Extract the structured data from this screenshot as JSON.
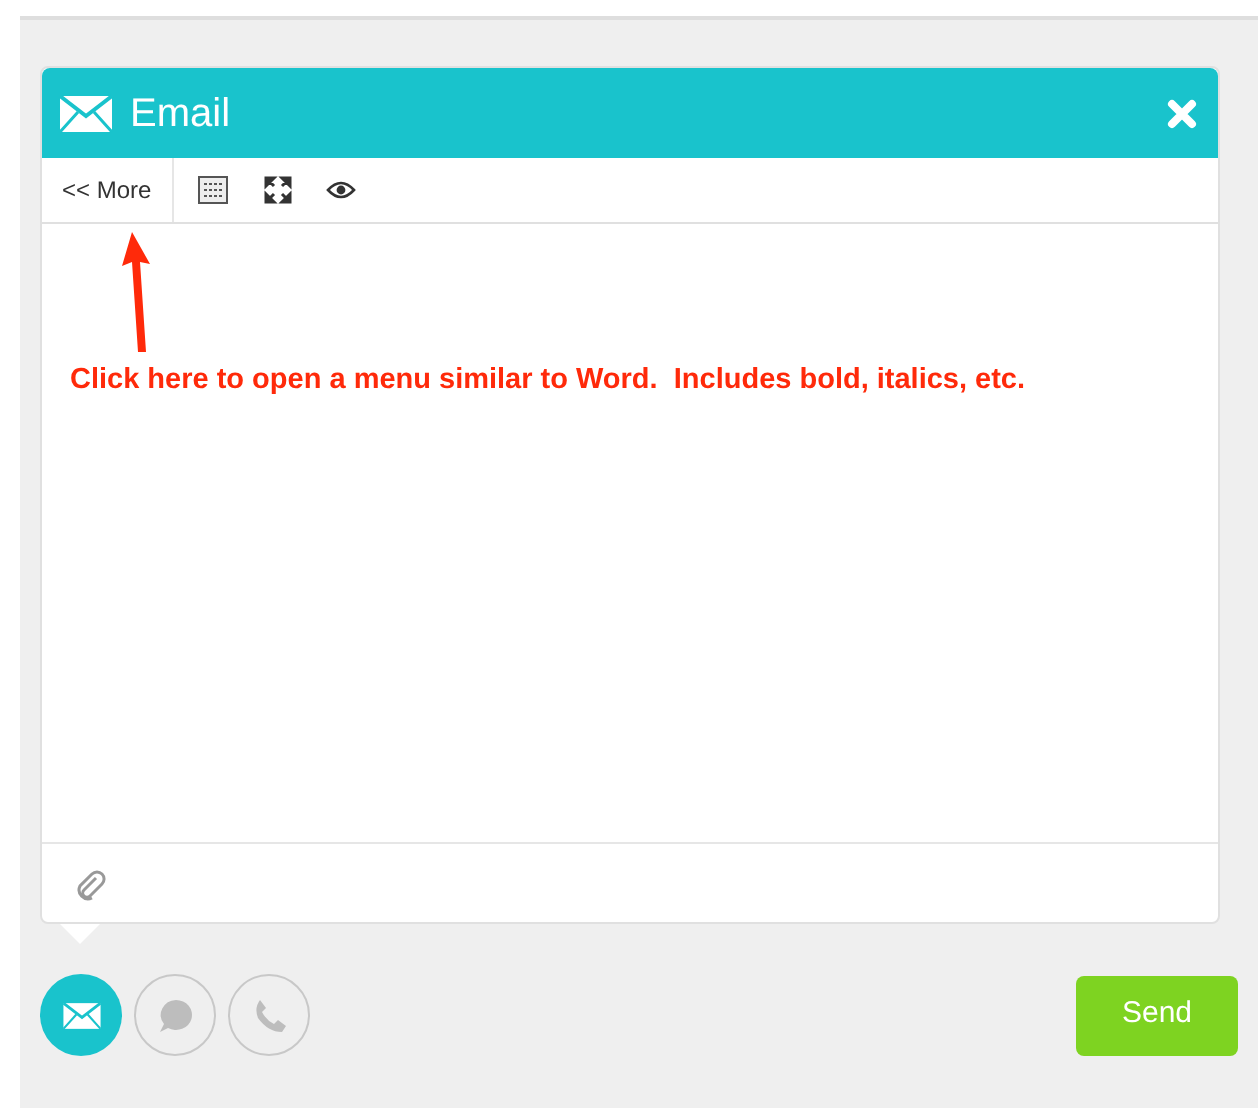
{
  "dialog": {
    "title": "Email"
  },
  "toolbar": {
    "more_button": "<< More"
  },
  "annotation": {
    "text": "Click here to open a menu similar to Word.  Includes bold, italics, etc."
  },
  "channels": [
    {
      "kind": "email",
      "selected": true
    },
    {
      "kind": "chat",
      "selected": false
    },
    {
      "kind": "phone",
      "selected": false
    }
  ],
  "send_button": "Send"
}
